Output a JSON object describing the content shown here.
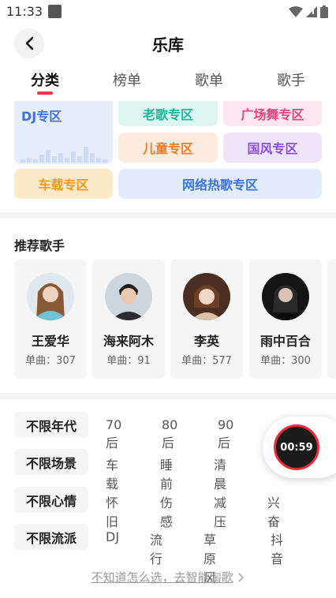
{
  "status_bar": {
    "time": "11:33"
  },
  "header": {
    "title": "乐库"
  },
  "tabs": [
    {
      "label": "分类",
      "active": true
    },
    {
      "label": "榜单",
      "active": false
    },
    {
      "label": "歌单",
      "active": false
    },
    {
      "label": "歌手",
      "active": false
    }
  ],
  "categories": {
    "dj": "DJ专区",
    "old_songs": "老歌专区",
    "square_dance": "广场舞专区",
    "kids": "儿童专区",
    "guofeng": "国风专区",
    "car": "车载专区",
    "net_hits": "网络热歌专区"
  },
  "singers_section": {
    "title": "推荐歌手",
    "singers": [
      {
        "name": "王爱华",
        "count": "单曲：307"
      },
      {
        "name": "海来阿木",
        "count": "单曲：91"
      },
      {
        "name": "李英",
        "count": "单曲：577"
      },
      {
        "name": "雨中百合",
        "count": "单曲：300"
      }
    ]
  },
  "filters": [
    {
      "lead": "不限年代",
      "options": [
        "70后",
        "80后",
        "90后"
      ]
    },
    {
      "lead": "不限场景",
      "options": [
        "车载",
        "睡前",
        "清晨"
      ]
    },
    {
      "lead": "不限心情",
      "options": [
        "怀旧",
        "伤感",
        "减压",
        "兴奋"
      ]
    },
    {
      "lead": "不限流派",
      "options": [
        "DJ",
        "流行",
        "草原风",
        "抖音"
      ]
    }
  ],
  "player": {
    "time": "00:59"
  },
  "smart_link": {
    "text": "不知道怎么选，去智能淘歌"
  },
  "colors": {
    "accent": "#f2334a",
    "player_ring": "#ef2a3c"
  }
}
